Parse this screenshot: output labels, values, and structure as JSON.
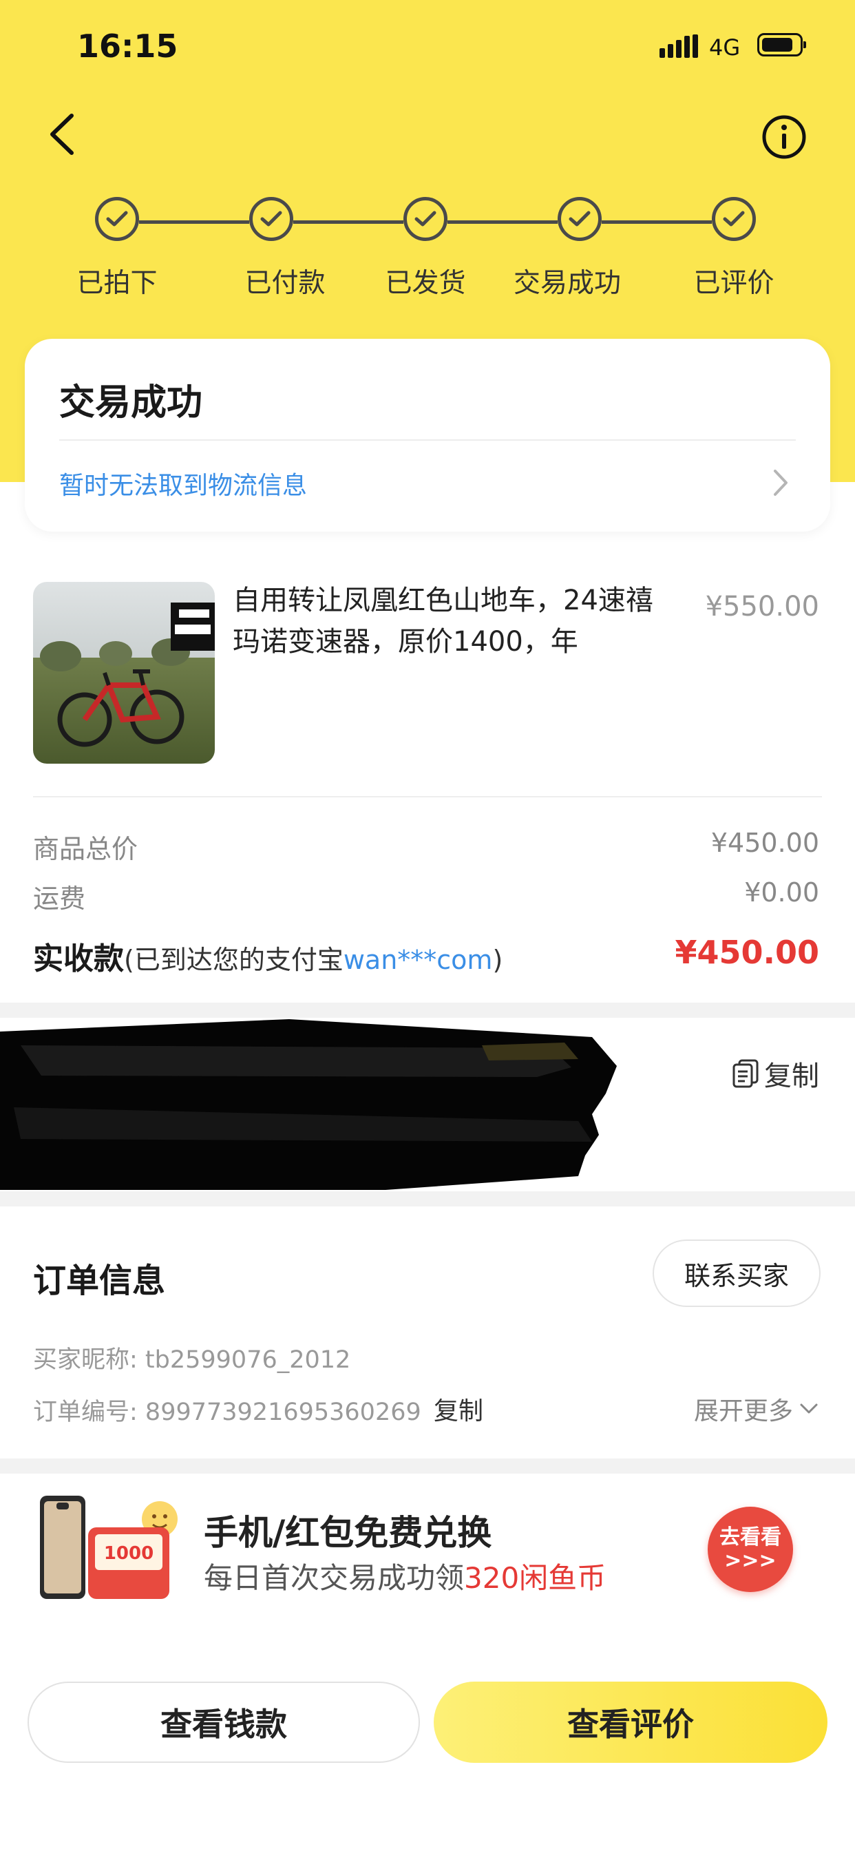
{
  "status_bar": {
    "time": "16:15",
    "network": "4G"
  },
  "steps": [
    {
      "label": "已拍下"
    },
    {
      "label": "已付款"
    },
    {
      "label": "已发货"
    },
    {
      "label": "交易成功"
    },
    {
      "label": "已评价"
    }
  ],
  "status_card": {
    "title": "交易成功",
    "logistics_text": "暂时无法取到物流信息"
  },
  "product": {
    "title": "自用转让凤凰红色山地车，24速禧玛诺变速器，原价1400，年",
    "price": "¥550.00"
  },
  "price_summary": {
    "subtotal_label": "商品总价",
    "subtotal_value": "¥450.00",
    "shipping_label": "运费",
    "shipping_value": "¥0.00",
    "received_label": "实收款",
    "received_note_prefix": "(已到达您的支付宝",
    "received_account": "wan***com",
    "received_note_suffix": ")",
    "received_value": "¥450.00"
  },
  "address": {
    "copy_label": "复制"
  },
  "order_info": {
    "title": "订单信息",
    "contact_label": "联系买家",
    "buyer_nick_label": "买家昵称: ",
    "buyer_nick": "tb2599076_2012",
    "order_no_label": "订单编号: ",
    "order_no": "899773921695360269",
    "copy_label": "复制",
    "expand_label": "展开更多"
  },
  "promo": {
    "title": "手机/红包免费兑换",
    "subtitle_prefix": "每日首次交易成功领",
    "subtitle_highlight": "320闲鱼币",
    "coupon_text": "1000",
    "go_label_line1": "去看看",
    "go_label_line2": ">>>"
  },
  "bottom_bar": {
    "money_label": "查看钱款",
    "review_label": "查看评价"
  },
  "colors": {
    "brand_yellow": "#fbe64f",
    "link_blue": "#3a8ee6",
    "price_red": "#e53935"
  }
}
